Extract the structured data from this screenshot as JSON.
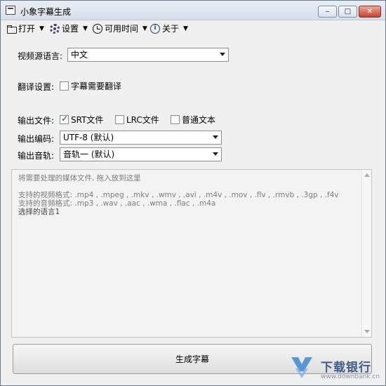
{
  "window": {
    "title": "小象字幕生成",
    "controls": {
      "minimize": "‒",
      "maximize": "□",
      "close": "✕"
    }
  },
  "menu": {
    "items": [
      {
        "label": "打开",
        "icon": "folder-icon"
      },
      {
        "label": "设置",
        "icon": "gear-icon"
      },
      {
        "label": "可用时间",
        "icon": "clock-icon"
      },
      {
        "label": "关于",
        "icon": "info-icon"
      }
    ],
    "caret": "▼",
    "info_glyph": "i"
  },
  "form": {
    "source_language": {
      "label": "视频源语言:",
      "value": "中文"
    },
    "translation": {
      "label": "翻译设置:",
      "checkbox_label": "字幕需要翻译",
      "checked": false
    },
    "output_files": {
      "label": "输出文件:",
      "options": [
        {
          "label": "SRT文件",
          "checked": true
        },
        {
          "label": "LRC文件",
          "checked": false
        },
        {
          "label": "普通文本",
          "checked": false
        }
      ]
    },
    "output_encoding": {
      "label": "输出编码:",
      "value": "UTF-8  (默认)"
    },
    "output_audio_track": {
      "label": "输出音轨:",
      "value": "音轨一 (默认)"
    }
  },
  "dropzone": {
    "placeholder": "将需要处理的媒体文件, 拖入放到这里",
    "video_formats": "支持的视频格式: .mp4 , .mpeg , .mkv , .wmv , .avi , .m4v , .mov , .flv , .rmvb , .3gp , .f4v",
    "audio_formats": "支持的音频格式: .mp3 , .wav , .aac , .wma , .flac , .m4a",
    "selected_language": "选择的语言1"
  },
  "generate_button": {
    "label": "生成字幕"
  },
  "watermark": {
    "name": "下载银行",
    "url": "www.downbank.cn"
  },
  "colors": {
    "titlebar": "#d6dfea",
    "close_button": "#c7432e",
    "window_bg": "#f0f0f0",
    "watermark_text": "#2f4f7f"
  }
}
